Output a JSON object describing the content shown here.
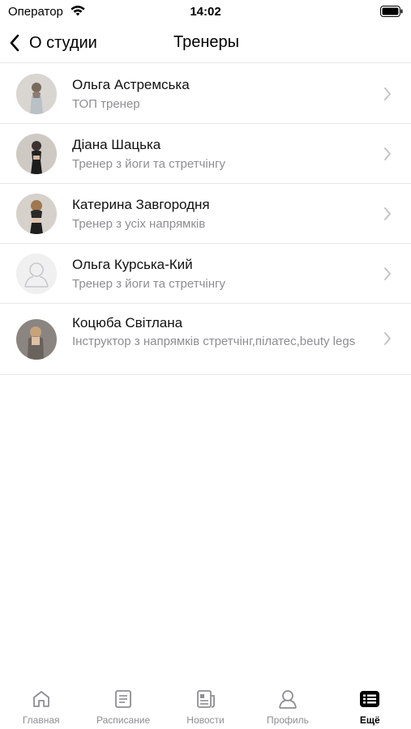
{
  "status_bar": {
    "carrier": "Оператор",
    "time": "14:02"
  },
  "nav": {
    "back_label": "О студии",
    "title": "Тренеры"
  },
  "trainers": [
    {
      "name": "Ольга Астремська",
      "role": "ТОП тренер",
      "avatar": "photo"
    },
    {
      "name": "Діана Шацька",
      "role": "Тренер з йоги та стретчінгу",
      "avatar": "photo"
    },
    {
      "name": "Катерина Завгородня",
      "role": "Тренер з усіх напрямків",
      "avatar": "photo"
    },
    {
      "name": "Ольга Курська-Кий",
      "role": "Тренер з йоги та стретчінгу",
      "avatar": "placeholder-person-icon"
    },
    {
      "name": "Коцюба Світлана",
      "role": "Інструктор з напрямків стретчінг,пілатес,beuty legs",
      "avatar": "photo"
    }
  ],
  "tabs": [
    {
      "label": "Главная",
      "icon": "home-icon"
    },
    {
      "label": "Расписание",
      "icon": "schedule-icon"
    },
    {
      "label": "Новости",
      "icon": "news-icon"
    },
    {
      "label": "Профиль",
      "icon": "profile-icon"
    },
    {
      "label": "Ещё",
      "icon": "more-list-icon",
      "active": true
    }
  ],
  "colors": {
    "secondary_text": "#8e8e93",
    "separator": "#e6e6e6",
    "active_tab": "#000000"
  }
}
